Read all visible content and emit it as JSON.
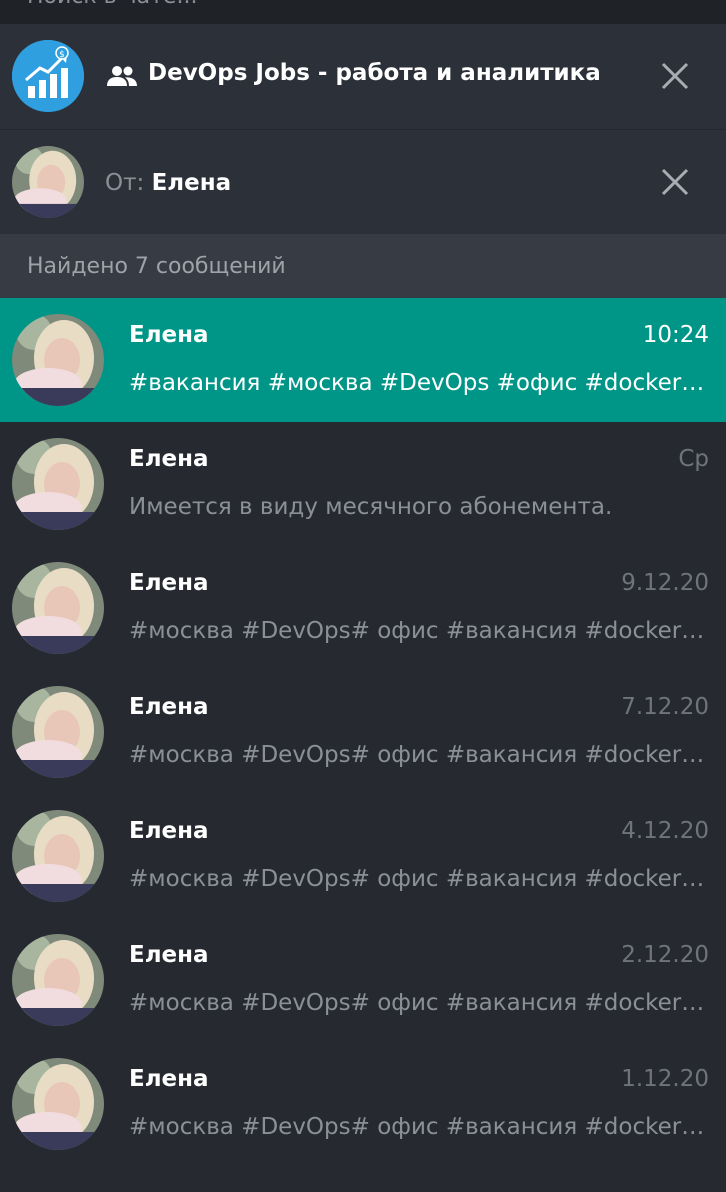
{
  "search": {
    "placeholder": "Поиск в чате..."
  },
  "chat_filter": {
    "title": "DevOps Jobs - работа и аналитика",
    "avatar_icon": "chart-growth-dollar-icon",
    "type_icon": "group-icon",
    "close_icon": "close-icon"
  },
  "from_filter": {
    "prefix": "От:",
    "name": "Елена",
    "close_icon": "close-icon"
  },
  "results": {
    "count_text": "Найдено 7 сообщений",
    "items": [
      {
        "sender": "Елена",
        "date": "10:24",
        "preview": "#вакансия #москва #DevOps #офис #docker #kubernetes",
        "selected": true
      },
      {
        "sender": "Елена",
        "date": "Ср",
        "preview": "Имеется в виду месячного абонемента.",
        "selected": false
      },
      {
        "sender": "Елена",
        "date": "9.12.20",
        "preview": "#москва #DevOps# офис #вакансия #docker #kubernetes",
        "selected": false
      },
      {
        "sender": "Елена",
        "date": "7.12.20",
        "preview": "#москва #DevOps# офис #вакансия #docker #kubernetes",
        "selected": false
      },
      {
        "sender": "Елена",
        "date": "4.12.20",
        "preview": "#москва #DevOps# офис #вакансия #docker #kubernetes",
        "selected": false
      },
      {
        "sender": "Елена",
        "date": "2.12.20",
        "preview": "#москва #DevOps# офис #вакансия #docker #kubernetes",
        "selected": false
      },
      {
        "sender": "Елена",
        "date": "1.12.20",
        "preview": "#москва #DevOps# офис #вакансия #docker #kubernetes",
        "selected": false
      }
    ]
  },
  "colors": {
    "background": "#262a30",
    "panel": "#2c3038",
    "header": "#363b44",
    "accent_selected": "#009687",
    "channel_avatar": "#2f9fe0"
  }
}
